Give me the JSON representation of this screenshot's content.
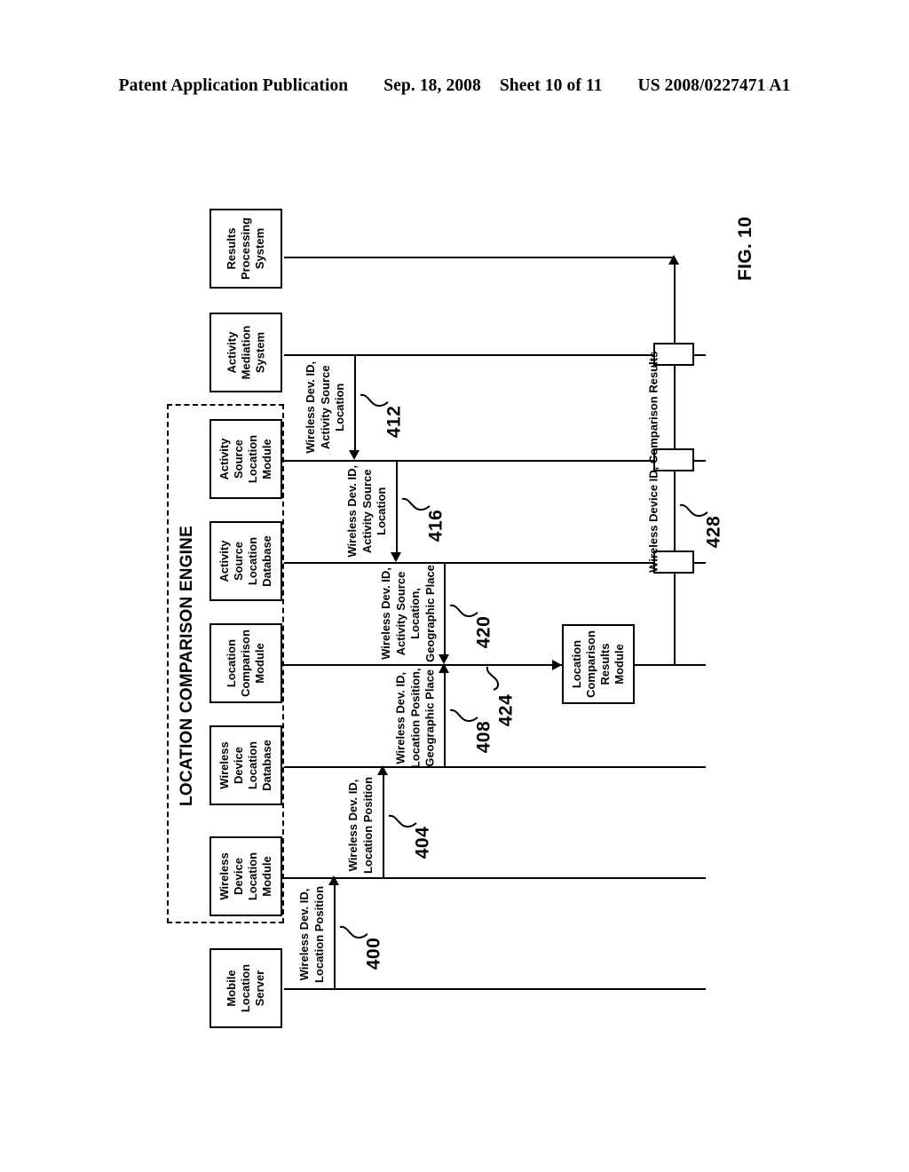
{
  "header": {
    "publication": "Patent Application Publication",
    "date": "Sep. 18, 2008",
    "sheet": "Sheet 10 of 11",
    "patent_number": "US 2008/0227471 A1"
  },
  "figure": {
    "caption": "FIG. 10",
    "engine_label": "LOCATION COMPARISON ENGINE",
    "nodes": [
      {
        "id": "results-processing-system",
        "lines": [
          "Results",
          "Processing",
          "System"
        ]
      },
      {
        "id": "activity-mediation-system",
        "lines": [
          "Activity",
          "Mediation",
          "System"
        ]
      },
      {
        "id": "activity-source-location-module",
        "lines": [
          "Activity",
          "Source",
          "Location",
          "Module"
        ]
      },
      {
        "id": "activity-source-location-db",
        "lines": [
          "Activity",
          "Source",
          "Location",
          "Database"
        ]
      },
      {
        "id": "location-comparison-module",
        "lines": [
          "Location",
          "Comparison",
          "Module"
        ]
      },
      {
        "id": "wireless-device-location-db",
        "lines": [
          "Wireless",
          "Device",
          "Location",
          "Database"
        ]
      },
      {
        "id": "wireless-device-location-module",
        "lines": [
          "Wireless",
          "Device",
          "Location",
          "Module"
        ]
      },
      {
        "id": "mobile-location-server",
        "lines": [
          "Mobile",
          "Location",
          "Server"
        ]
      },
      {
        "id": "location-comparison-results-module",
        "lines": [
          "Location",
          "Comparison",
          "Results",
          "Module"
        ]
      }
    ],
    "messages": [
      {
        "ref": "400",
        "lines": [
          "Wireless Dev. ID,",
          "Location Position"
        ]
      },
      {
        "ref": "404",
        "lines": [
          "Wireless Dev. ID,",
          "Location Position"
        ]
      },
      {
        "ref": "408",
        "lines": [
          "Wireless Dev. ID,",
          "Location Position,",
          "Geographic Place"
        ]
      },
      {
        "ref": "412",
        "lines": [
          "Wireless Dev. ID,",
          "Activity Source",
          "Location"
        ]
      },
      {
        "ref": "416",
        "lines": [
          "Wireless Dev. ID,",
          "Activity Source",
          "Location"
        ]
      },
      {
        "ref": "420",
        "lines": [
          "Wireless Dev. ID,",
          "Activity Source",
          "Location,",
          "Geographic Place"
        ]
      },
      {
        "ref": "424",
        "lines": []
      },
      {
        "ref": "428",
        "lines": [
          "Wireless Device ID, Comparison Results"
        ]
      }
    ]
  }
}
